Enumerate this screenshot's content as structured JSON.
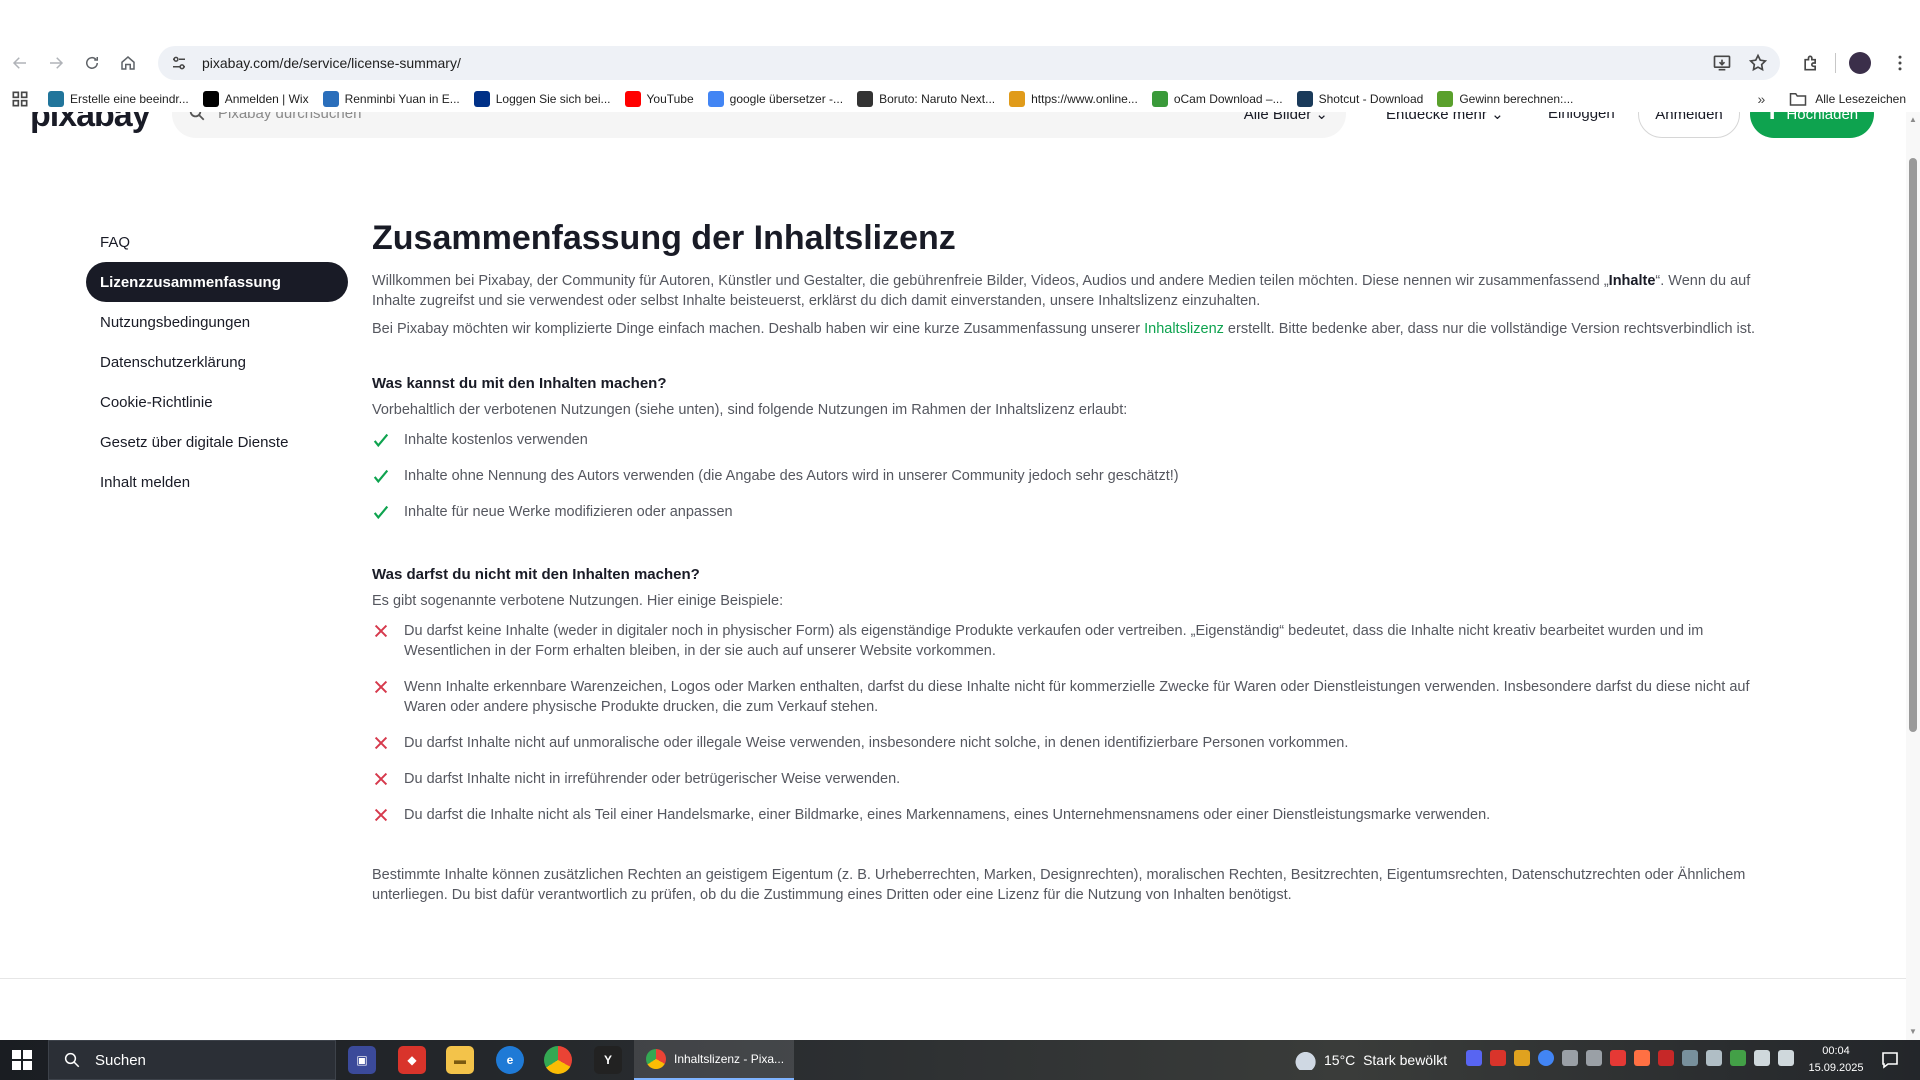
{
  "browser": {
    "url": "pixabay.com/de/service/license-summary/",
    "bookmarks": [
      {
        "label": "Erstelle eine beeindr...",
        "icon": "wordpress-icon",
        "color": "#21759b"
      },
      {
        "label": "Anmelden | Wix",
        "icon": "wix-icon",
        "color": "#000000"
      },
      {
        "label": "Renminbi Yuan in E...",
        "icon": "currency-icon",
        "color": "#2a6ebb"
      },
      {
        "label": "Loggen Sie sich bei...",
        "icon": "paypal-icon",
        "color": "#003087"
      },
      {
        "label": "YouTube",
        "icon": "youtube-icon",
        "color": "#ff0000"
      },
      {
        "label": "google übersetzer -...",
        "icon": "google-icon",
        "color": "#4285f4"
      },
      {
        "label": "Boruto: Naruto Next...",
        "icon": "boruto-icon",
        "color": "#333333"
      },
      {
        "label": "https://www.online...",
        "icon": "grid-dots-icon",
        "color": "#e09b1a"
      },
      {
        "label": "oCam Download –...",
        "icon": "ocam-icon",
        "color": "#3a9a3a"
      },
      {
        "label": "Shotcut - Download",
        "icon": "shotcut-icon",
        "color": "#1a3a5a"
      },
      {
        "label": "Gewinn berechnen:...",
        "icon": "leaf-icon",
        "color": "#5aa02c"
      }
    ],
    "all_bookmarks": "Alle Lesezeichen"
  },
  "header": {
    "logo": "pixabay",
    "search_placeholder": "Pixabay durchsuchen",
    "filter": "Alle Bilder",
    "explore": "Entdecke mehr",
    "login": "Einloggen",
    "signup": "Anmelden",
    "upload": "Hochladen"
  },
  "sidebar": {
    "items": [
      {
        "label": "FAQ"
      },
      {
        "label": "Lizenzzusammenfassung"
      },
      {
        "label": "Nutzungsbedingungen"
      },
      {
        "label": "Datenschutzerklärung"
      },
      {
        "label": "Cookie-Richtlinie"
      },
      {
        "label": "Gesetz über digitale Dienste"
      },
      {
        "label": "Inhalt melden"
      }
    ]
  },
  "main": {
    "title": "Zusammenfassung der Inhaltslizenz",
    "intro1_a": "Willkommen bei Pixabay, der Community für Autoren, Künstler und Gestalter, die gebührenfreie Bilder, Videos, Audios und andere Medien teilen möchten. Diese nennen wir zusammenfassend „",
    "intro1_b": "Inhalte",
    "intro1_c": "“. Wenn du auf Inhalte zugreifst und sie verwendest oder selbst Inhalte beisteuerst, erklärst du dich damit einverstanden, unsere Inhaltslizenz einzuhalten.",
    "intro2_a": "Bei Pixabay möchten wir komplizierte Dinge einfach machen. Deshalb haben wir eine kurze Zusammenfassung unserer ",
    "intro2_link": "Inhaltslizenz",
    "intro2_c": " erstellt. Bitte bedenke aber, dass nur die vollständige Version rechtsverbindlich ist.",
    "allowed_heading": "Was kannst du mit den Inhalten machen?",
    "allowed_intro": "Vorbehaltlich der verbotenen Nutzungen (siehe unten), sind folgende Nutzungen im Rahmen der Inhaltslizenz erlaubt:",
    "allowed": [
      "Inhalte kostenlos verwenden",
      "Inhalte ohne Nennung des Autors verwenden (die Angabe des Autors wird in unserer Community jedoch sehr geschätzt!)",
      "Inhalte für neue Werke modifizieren oder anpassen"
    ],
    "forbidden_heading": "Was darfst du nicht mit den Inhalten machen?",
    "forbidden_intro": "Es gibt sogenannte verbotene Nutzungen. Hier einige Beispiele:",
    "forbidden": [
      "Du darfst keine Inhalte (weder in digitaler noch in physischer Form) als eigenständige Produkte verkaufen oder vertreiben. „Eigenständig“ bedeutet, dass die Inhalte nicht kreativ bearbeitet wurden und im Wesentlichen in der Form erhalten bleiben, in der sie auch auf unserer Website vorkommen.",
      "Wenn Inhalte erkennbare Warenzeichen, Logos oder Marken enthalten, darfst du diese Inhalte nicht für kommerzielle Zwecke für Waren oder Dienstleistungen verwenden. Insbesondere darfst du diese nicht auf Waren oder andere physische Produkte drucken, die zum Verkauf stehen.",
      "Du darfst Inhalte nicht auf unmoralische oder illegale Weise verwenden, insbesondere nicht solche, in denen identifizierbare Personen vorkommen.",
      "Du darfst Inhalte nicht in irreführender oder betrügerischer Weise verwenden.",
      "Du darfst die Inhalte nicht als Teil einer Handelsmarke, einer Bildmarke, eines Markennamens, eines Unternehmensnamens oder einer Dienstleistungsmarke verwenden."
    ],
    "footer_note": "Bestimmte Inhalte können zusätzlichen Rechten an geistigem Eigentum (z. B. Urheberrechten, Marken, Designrechten), moralischen Rechten, Besitzrechten, Eigentumsrechten, Datenschutzrechten oder Ähnlichem unterliegen. Du bist dafür verantwortlich zu prüfen, ob du die Zustimmung eines Dritten oder eine Lizenz für die Nutzung von Inhalten benötigst."
  },
  "taskbar": {
    "search": "Suchen",
    "active_window": "Inhaltslizenz - Pixa...",
    "temperature": "15°C",
    "weather": "Stark bewölkt",
    "time": "00:04",
    "date": "15.09.2025"
  },
  "colors": {
    "accent_green": "#0ea34f",
    "cross_red": "#d6394c",
    "dark": "#191b26"
  }
}
